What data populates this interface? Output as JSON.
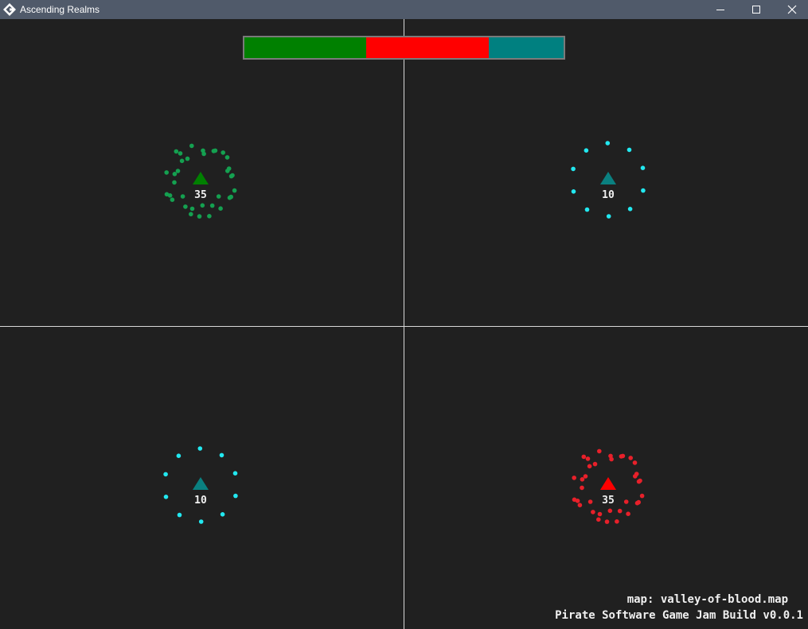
{
  "window": {
    "title": "Ascending Realms",
    "icon": "gamemaker-logo",
    "controls": [
      "minimize-icon",
      "maximize-icon",
      "close-icon"
    ]
  },
  "colors": {
    "background": "#202020",
    "green": "#008000",
    "red": "#ff0000",
    "teal": "#008080",
    "green_unit": "#14a050",
    "red_unit": "#e8202a",
    "cyan_unit": "#22e8f0",
    "neutral_marker": "#0a8080"
  },
  "power_bar": {
    "segments": [
      {
        "team": "green",
        "share": 0.3825,
        "color": "#008000"
      },
      {
        "team": "red",
        "share": 0.3825,
        "color": "#ff0000"
      },
      {
        "team": "neutral",
        "share": 0.235,
        "color": "#008080"
      }
    ]
  },
  "realms": [
    {
      "id": "top-left",
      "team": "green",
      "count": "35",
      "units": 35,
      "marker_color": "#008000",
      "unit_color": "#14a050"
    },
    {
      "id": "top-right",
      "team": "neutral",
      "count": "10",
      "units": 10,
      "marker_color": "#0a8080",
      "unit_color": "#22e8f0"
    },
    {
      "id": "bottom-left",
      "team": "neutral",
      "count": "10",
      "units": 10,
      "marker_color": "#0a8080",
      "unit_color": "#22e8f0"
    },
    {
      "id": "bottom-right",
      "team": "red",
      "count": "35",
      "units": 35,
      "marker_color": "#ff0000",
      "unit_color": "#e8202a"
    }
  ],
  "hud": {
    "map": "map: valley-of-blood.map",
    "build": "Pirate Software Game Jam Build v0.0.1"
  }
}
